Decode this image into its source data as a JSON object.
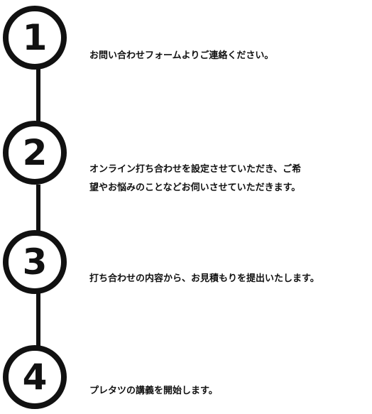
{
  "steps": [
    {
      "number": "1",
      "text": "お問い合わせフォームよりご連絡ください。"
    },
    {
      "number": "2",
      "line1": "オンライン打ち合わせを設定させていただき、ご希",
      "line2": "望やお悩みのことなどお伺いさせていただきます。"
    },
    {
      "number": "3",
      "text": "打ち合わせの内容から、お見積もりを提出いたします。"
    },
    {
      "number": "4",
      "text": "プレタツの講義を開始します。"
    }
  ],
  "colors": {
    "line": "#111111",
    "background": "#ffffff"
  }
}
